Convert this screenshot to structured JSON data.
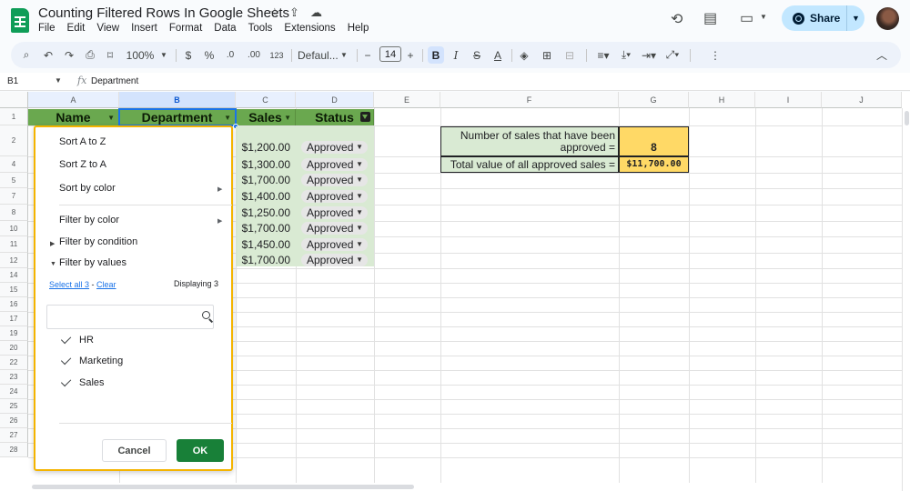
{
  "app": {
    "doc_title": "Counting Filtered Rows In Google Sheets",
    "menu": [
      "File",
      "Edit",
      "View",
      "Insert",
      "Format",
      "Data",
      "Tools",
      "Extensions",
      "Help"
    ],
    "share_label": "Share"
  },
  "toolbar": {
    "zoom": "100%",
    "currency": "$",
    "percent": "%",
    "dec_decrease": ".0",
    "dec_increase": ".00",
    "number_format": "123",
    "font": "Defaul...",
    "font_size": "14",
    "bold": "B",
    "italic": "I",
    "strike": "S",
    "text_color": "A"
  },
  "formula_bar": {
    "cell_ref": "B1",
    "fx": "fx",
    "content": "Department"
  },
  "columns": [
    "A",
    "B",
    "C",
    "D",
    "E",
    "F",
    "G",
    "H",
    "I",
    "J"
  ],
  "rows": [
    "1",
    "2",
    "4",
    "5",
    "7",
    "8",
    "10",
    "11",
    "12",
    "14",
    "15",
    "16",
    "17",
    "19",
    "20",
    "22",
    "23",
    "24",
    "25",
    "26",
    "27",
    "28"
  ],
  "table": {
    "headers": [
      "Name",
      "Department",
      "Sales",
      "Status"
    ],
    "sales": [
      "$1,200.00",
      "$1,300.00",
      "$1,700.00",
      "$1,400.00",
      "$1,250.00",
      "$1,700.00",
      "$1,450.00",
      "$1,700.00"
    ],
    "status": [
      "Approved",
      "Approved",
      "Approved",
      "Approved",
      "Approved",
      "Approved",
      "Approved",
      "Approved"
    ]
  },
  "summary": {
    "count_label_line1": "Number of sales that have been",
    "count_label_line2": "approved =",
    "count_value": "8",
    "total_label": "Total value of all approved sales =",
    "total_value": "$11,700.00"
  },
  "filter_popup": {
    "sort_az": "Sort A to Z",
    "sort_za": "Sort Z to A",
    "sort_color": "Sort by color",
    "filter_color": "Filter by color",
    "filter_condition": "Filter by condition",
    "filter_values": "Filter by values",
    "select_all": "Select all 3",
    "separator": " - ",
    "clear": "Clear",
    "displaying": "Displaying 3",
    "search_placeholder": "",
    "values": [
      "HR",
      "Marketing",
      "Sales"
    ],
    "cancel": "Cancel",
    "ok": "OK"
  },
  "colors": {
    "header_green": "#6aa84f",
    "data_green": "#d9ead3",
    "summary_yellow": "#ffd966",
    "popup_border": "#f4b400",
    "ok_green": "#188038",
    "share_blue": "#c2e7ff"
  },
  "icons": [
    "sheets-logo-icon",
    "star-icon",
    "move-icon",
    "cloud-icon",
    "history-icon",
    "comment-icon",
    "video-icon",
    "globe-icon",
    "search-icon",
    "undo-icon",
    "redo-icon",
    "print-icon",
    "paint-format-icon",
    "filter-icon",
    "check-icon"
  ]
}
